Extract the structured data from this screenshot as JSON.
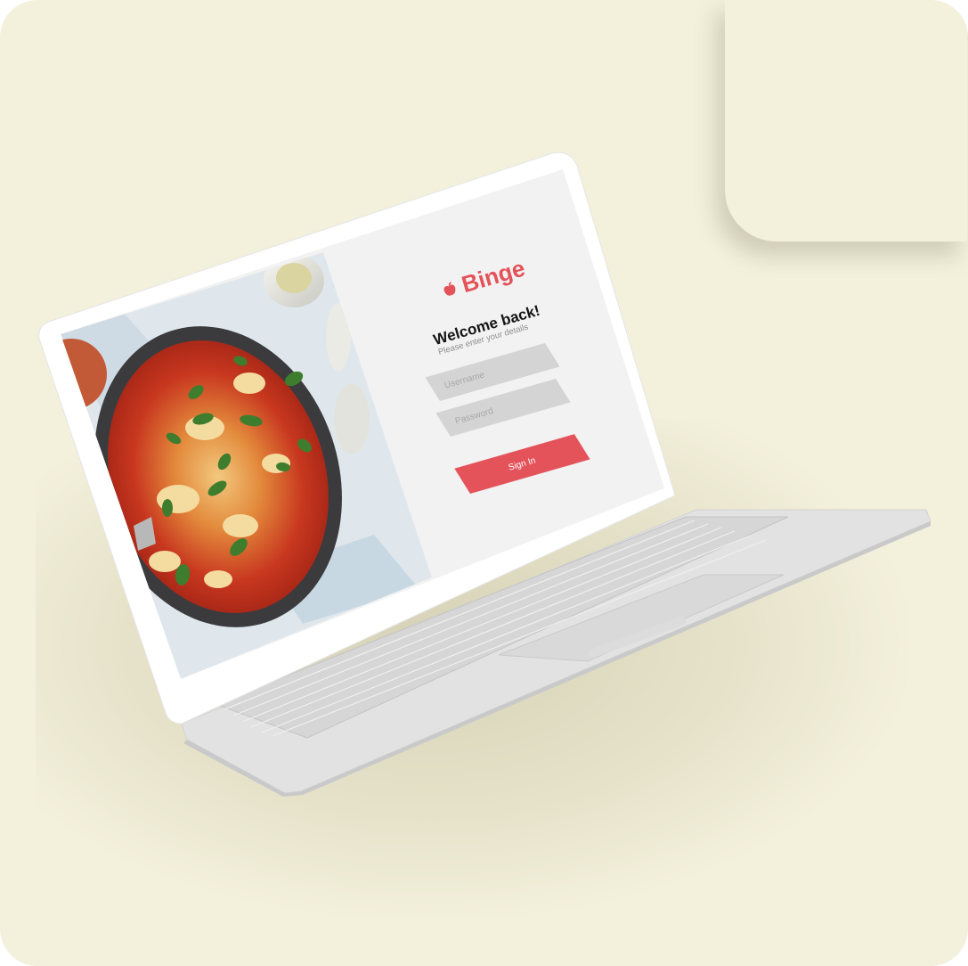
{
  "brand": {
    "name": "Binge",
    "accent": "#e4525a"
  },
  "login": {
    "title": "Welcome back!",
    "subtitle": "Please enter your details",
    "username_placeholder": "Username",
    "password_placeholder": "Password",
    "signin_label": "Sign In"
  },
  "icons": {
    "logo": "apple-icon"
  },
  "colors": {
    "background": "#f3f0dc",
    "input_bg": "#d4d4d4",
    "screen_bg": "#f2f2f2",
    "laptop_body": "#e8e8e8"
  }
}
